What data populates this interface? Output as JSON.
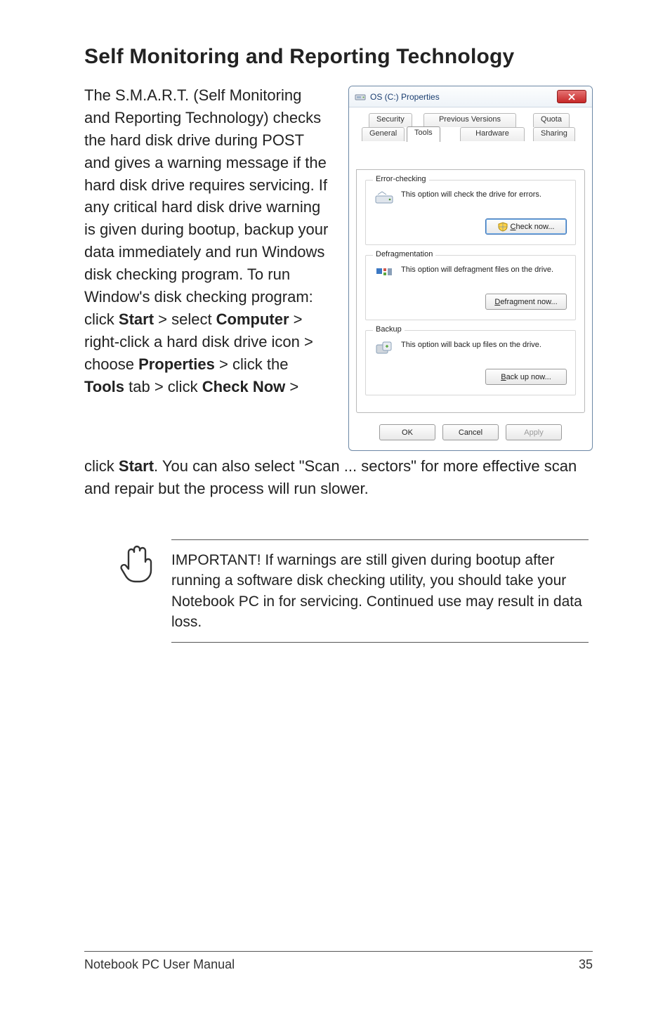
{
  "heading": "Self Monitoring and Reporting Technology",
  "para1_pre": "The S.M.A.R.T. (Self Monitoring and Reporting Technology) checks the hard disk drive during POST and gives a warning message if the hard disk drive requires servicing. If any critical hard disk drive warning is given during bootup, backup your data immediately and run Windows disk checking program. To run Window's disk checking program: click ",
  "b_start": "Start",
  "t_gt1": " > select ",
  "b_computer": "Computer",
  "t_gt2": " > right-click a hard disk drive icon > choose ",
  "b_properties": "Properties",
  "t_gt3": " > click the ",
  "b_tools": "Tools",
  "t_gt4": " tab > click ",
  "b_checknow": "Check Now",
  "t_gt5": " > ",
  "para2_pre": "click ",
  "b_start2": "Start",
  "para2_post": ". You can also select \"Scan ... sectors\" for more effective scan and repair but the process will run slower.",
  "note": "IMPORTANT! If warnings are still given during bootup after running a software disk checking utility, you should take your Notebook PC in for servicing. Continued use may result in data loss.",
  "footer_left": "Notebook PC User Manual",
  "footer_right": "35",
  "dialog": {
    "title": "OS (C:) Properties",
    "tabs": {
      "security": "Security",
      "previous": "Previous Versions",
      "quota": "Quota",
      "general": "General",
      "tools": "Tools",
      "hardware": "Hardware",
      "sharing": "Sharing"
    },
    "error": {
      "legend": "Error-checking",
      "text": "This option will check the drive for errors.",
      "btn_u": "C",
      "btn_rest": "heck now..."
    },
    "defrag": {
      "legend": "Defragmentation",
      "text": "This option will defragment files on the drive.",
      "btn_u": "D",
      "btn_rest": "efragment now..."
    },
    "backup": {
      "legend": "Backup",
      "text": "This option will back up files on the drive.",
      "btn_u": "B",
      "btn_rest": "ack up now..."
    },
    "ok": "OK",
    "cancel": "Cancel",
    "apply": "Apply"
  }
}
